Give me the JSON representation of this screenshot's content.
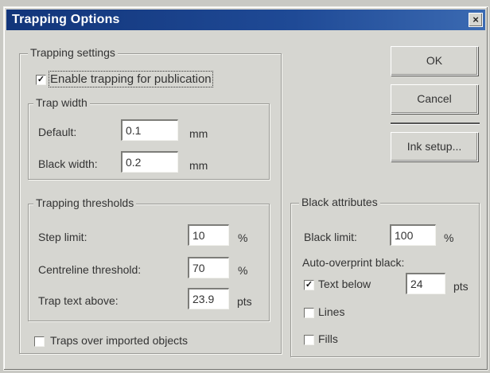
{
  "window": {
    "title": "Trapping Options",
    "close_glyph": "×"
  },
  "trapping_settings": {
    "legend": "Trapping settings",
    "enable_label": "Enable trapping for publication",
    "enable_checked_glyph": "✓",
    "trap_width": {
      "legend": "Trap width",
      "default_label": "Default:",
      "default_value": "0.1",
      "default_unit": "mm",
      "black_width_label": "Black width:",
      "black_width_value": "0.2",
      "black_width_unit": "mm"
    },
    "thresholds": {
      "legend": "Trapping thresholds",
      "step_limit_label": "Step limit:",
      "step_limit_value": "10",
      "step_limit_unit": "%",
      "centreline_label": "Centreline threshold:",
      "centreline_value": "70",
      "centreline_unit": "%",
      "trap_text_label": "Trap text above:",
      "trap_text_value": "23.9",
      "trap_text_unit": "pts"
    },
    "traps_over_label": "Traps over imported objects"
  },
  "buttons": {
    "ok": "OK",
    "cancel": "Cancel",
    "ink_setup": "Ink setup..."
  },
  "black_attributes": {
    "legend": "Black attributes",
    "black_limit_label": "Black limit:",
    "black_limit_value": "100",
    "black_limit_unit": "%",
    "auto_overprint_label": "Auto-overprint black:",
    "text_below_label": "Text below",
    "text_below_checked_glyph": "✓",
    "text_below_value": "24",
    "text_below_unit": "pts",
    "lines_label": "Lines",
    "fills_label": "Fills"
  }
}
